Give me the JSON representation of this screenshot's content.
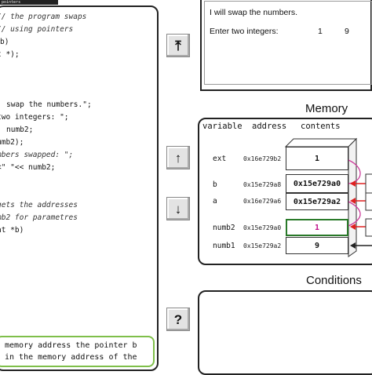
{
  "code_panel": {
    "tab_label": "pointers",
    "lines": [
      {
        "text": "// the program swaps",
        "kind": "comment"
      },
      {
        "text": "// using pointers",
        "kind": "comment"
      },
      {
        "text": "b)",
        "kind": "code"
      },
      {
        "text": "t *);",
        "kind": "code"
      },
      {
        "text": ";",
        "kind": "code"
      },
      {
        "text": "swap the numbers.\";",
        "kind": "code"
      },
      {
        "text": "two integers: \";",
        "kind": "code"
      },
      {
        "text": "numb2;",
        "kind": "code"
      },
      {
        "text": "umb2);",
        "kind": "code"
      },
      {
        "text": "mbers swapped: \";",
        "kind": "code"
      },
      {
        "text": "<\" \"<< numb2;",
        "kind": "code"
      },
      {
        "text": "gets the addresses",
        "kind": "comment"
      },
      {
        "text": "mb2 for parametres",
        "kind": "comment"
      },
      {
        "text": "nt *b)",
        "kind": "code"
      }
    ],
    "hint": [
      "memory address the pointer b",
      "in the memory address of the"
    ]
  },
  "controls": {
    "to_top_icon": "⤒",
    "up_icon": "↑",
    "down_icon": "↓",
    "help_icon": "?"
  },
  "console": {
    "line1": "I will swap the numbers.",
    "prompt": "Enter two integers:",
    "input1": "1",
    "input2": "9"
  },
  "memory": {
    "title": "Memory",
    "headers": {
      "variable": "variable",
      "address": "address",
      "contents": "contents"
    },
    "rows": [
      {
        "name": "ext",
        "address": "0x16e729b2",
        "value": "1",
        "highlight": false
      },
      {
        "name": "b",
        "address": "0x15e729a8",
        "value": "0x15e729a0",
        "highlight": false
      },
      {
        "name": "a",
        "address": "0x16e729a6",
        "value": "0x15e729a2",
        "highlight": false
      },
      {
        "name": "numb2",
        "address": "0x15e729a0",
        "value": "1",
        "highlight": true
      },
      {
        "name": "numb1",
        "address": "0x15e729a2",
        "value": "9",
        "highlight": false
      }
    ],
    "colors": {
      "pointer_arrow": "#e02020",
      "plain_arrow": "#222222",
      "highlight_cell": "#2a7a2a"
    }
  },
  "conditions": {
    "title": "Conditions"
  }
}
